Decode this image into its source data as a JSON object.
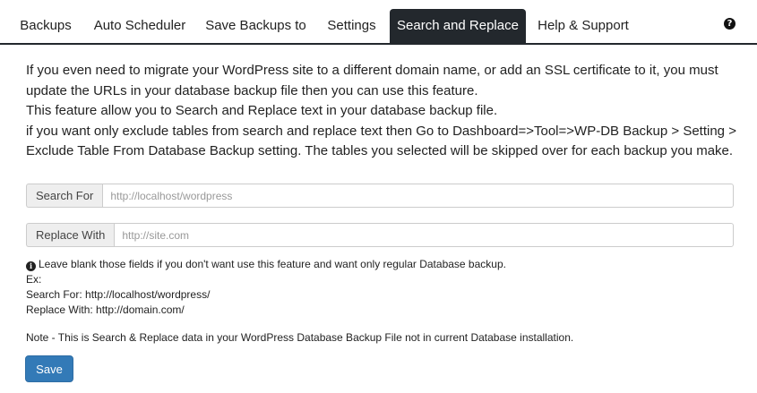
{
  "tabs": [
    {
      "label": "Backups",
      "active": false
    },
    {
      "label": "Auto Scheduler",
      "active": false
    },
    {
      "label": "Save Backups to",
      "active": false
    },
    {
      "label": "Settings",
      "active": false
    },
    {
      "label": "Search and Replace",
      "active": true
    },
    {
      "label": "Help & Support",
      "active": false
    }
  ],
  "help_icon": {
    "icon": "question-circle-icon",
    "glyph": "?"
  },
  "intro": {
    "line1": "If you even need to migrate your WordPress site to a different domain name, or add an SSL certificate to it, you must update the URLs in your database backup file then you can use this feature.",
    "line2": "This feature allow you to Search and Replace text in your database backup file.",
    "line3": "if you want only exclude tables from search and replace text then Go to Dashboard=>Tool=>WP-DB Backup > Setting > Exclude Table From Database Backup setting. The tables you selected will be skipped over for each backup you make."
  },
  "search_field": {
    "label": "Search For",
    "value": "",
    "placeholder": "http://localhost/wordpress"
  },
  "replace_field": {
    "label": "Replace With",
    "value": "",
    "placeholder": "http://site.com"
  },
  "notes": {
    "info_icon": "info-circle-icon",
    "info_glyph": "i",
    "leave_blank": "Leave blank those fields if you don't want use this feature and want only regular Database backup.",
    "ex": "Ex:",
    "example_search": "Search For: http://localhost/wordpress/",
    "example_replace": "Replace With: http://domain.com/"
  },
  "note_line": "Note - This is Search & Replace data in your WordPress Database Backup File not in current Database installation.",
  "save_button": {
    "label": "Save"
  },
  "colors": {
    "tab_active_bg": "#23282d",
    "button_primary": "#337ab7"
  }
}
